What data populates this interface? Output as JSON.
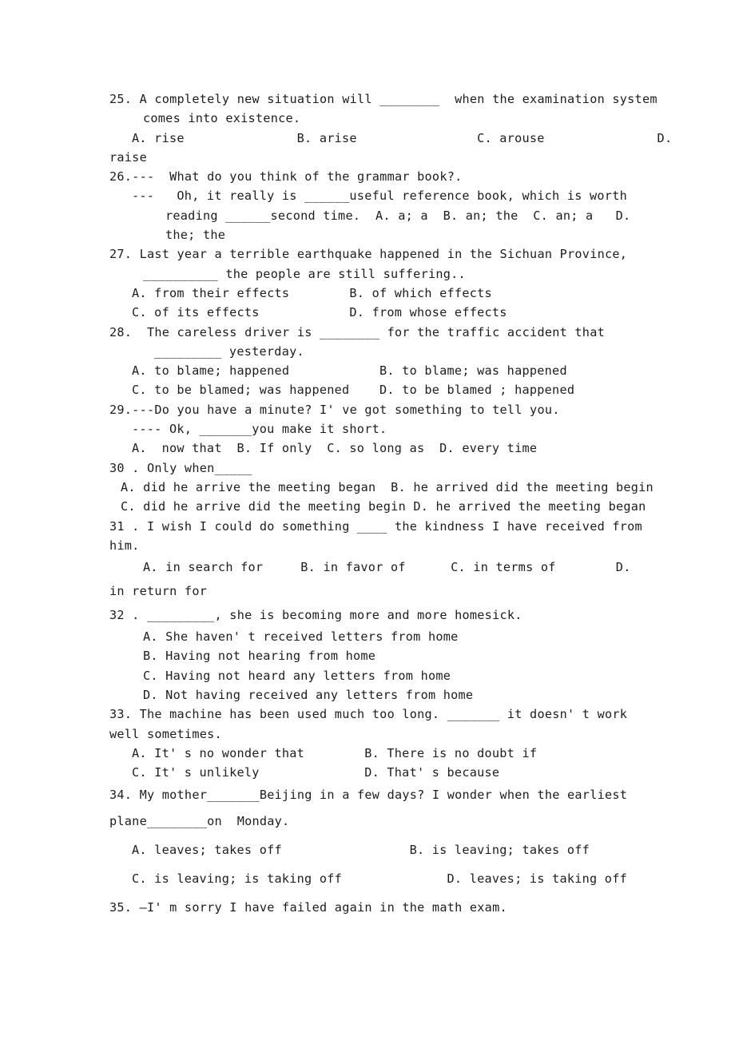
{
  "document": {
    "type": "english-grammar-multiple-choice-worksheet",
    "background_color": "#ffffff",
    "text_color": "#1d1d1d",
    "blank_placeholder": "________"
  },
  "questions": [
    {
      "number": "25.",
      "stem_lines": [
        "25. A completely new situation will ________  when the examination system",
        "   comes into existence."
      ],
      "option_lines": [
        "  A. rise                B. arise                 C. arouse               D.",
        "raise"
      ]
    },
    {
      "number": "26.",
      "stem_lines": [
        "26.---  What do you think of the grammar book?.",
        "  ---   Oh, it really is ______useful reference book, which is worth",
        "        reading ______second time.  A. a; a  B. an; the  C. an; a   D.",
        "        the; the"
      ],
      "option_lines": []
    },
    {
      "number": "27.",
      "stem_lines": [
        "27. Last year a terrible earthquake happened in the Sichuan Province,",
        "     __________ the people are still suffering.."
      ],
      "option_lines": [
        "  A. from their effects        B. of which effects",
        "  C. of its effects            D. from whose effects"
      ]
    },
    {
      "number": "28.",
      "stem_lines": [
        "28.  The careless driver is ________ for the traffic accident that",
        "      _________ yesterday."
      ],
      "option_lines": [
        "  A. to blame; happened            B. to blame; was happened",
        "  C. to be blamed; was happened    D. to be blamed ; happened"
      ]
    },
    {
      "number": "29.",
      "stem_lines": [
        "29.---Do you have a minute? I' ve got something to tell you.",
        "  ---- Ok, _______you make it short."
      ],
      "option_lines": [
        "  A.  now that  B. If only  C. so long as  D. every time"
      ]
    },
    {
      "number": "30.",
      "stem_lines": [
        "30 . Only when_____"
      ],
      "option_lines": [
        " A. did he arrive the meeting began  B. he arrived did the meeting begin",
        " C. did he arrive did the meeting begin D. he arrived the meeting began"
      ]
    },
    {
      "number": "31.",
      "stem_lines": [
        "31 . I wish I could do something ____ the kindness I have received from",
        "him."
      ],
      "option_lines": [
        "   A. in search for     B. in favor of      C. in terms of        D.",
        "in return for"
      ]
    },
    {
      "number": "32.",
      "stem_lines": [
        "32 . _________, she is becoming more and more homesick."
      ],
      "option_lines": [
        "   A. She haven' t received letters from home",
        "   B. Having not hearing from home",
        "   C. Having not heard any letters from home",
        "   D. Not having received any letters from home"
      ]
    },
    {
      "number": "33.",
      "stem_lines": [
        "33. The machine has been used much too long. _______ it doesn' t work",
        "well sometimes."
      ],
      "option_lines": [
        "   A. It' s no wonder that        B. There is no doubt if",
        "   C. It' s unlikely              D. That' s because"
      ]
    },
    {
      "number": "34.",
      "stem_lines": [
        "34. My mother_______Beijing in a few days? I wonder when the earliest",
        "plane________on  Monday."
      ],
      "option_lines": [
        "   A. leaves; takes off                 B. is leaving; takes off",
        "   C. is leaving; is taking off              D. leaves; is taking off"
      ]
    },
    {
      "number": "35.",
      "stem_lines": [
        "35. —I' m sorry I have failed again in the math exam."
      ],
      "option_lines": []
    }
  ],
  "lines": [
    {
      "id": "l01",
      "text": "25. A completely new situation will ________  when the examination system",
      "indent": 0,
      "spacing": "normal"
    },
    {
      "id": "l02",
      "text": "comes into existence.",
      "indent": 3,
      "spacing": "normal"
    },
    {
      "id": "l03",
      "text": "A. rise               B. arise                C. arouse               D.",
      "indent": 2,
      "spacing": "normal"
    },
    {
      "id": "l04",
      "text": "raise",
      "indent": 0,
      "spacing": "normal"
    },
    {
      "id": "l05",
      "text": "26.---  What do you think of the grammar book?.",
      "indent": 0,
      "spacing": "normal"
    },
    {
      "id": "l06",
      "text": "---   Oh, it really is ______useful reference book, which is worth",
      "indent": 2,
      "spacing": "normal"
    },
    {
      "id": "l07",
      "text": "reading ______second time.  A. a; a  B. an; the  C. an; a   D.",
      "indent": 5,
      "spacing": "normal"
    },
    {
      "id": "l08",
      "text": "the; the",
      "indent": 5,
      "spacing": "normal"
    },
    {
      "id": "l09",
      "text": "27. Last year a terrible earthquake happened in the Sichuan Province,",
      "indent": 0,
      "spacing": "normal"
    },
    {
      "id": "l10",
      "text": "__________ the people are still suffering..",
      "indent": 3,
      "spacing": "normal"
    },
    {
      "id": "l11",
      "text": "A. from their effects        B. of which effects",
      "indent": 2,
      "spacing": "normal"
    },
    {
      "id": "l12",
      "text": "C. of its effects            D. from whose effects",
      "indent": 2,
      "spacing": "normal"
    },
    {
      "id": "l13",
      "text": "28.  The careless driver is ________ for the traffic accident that",
      "indent": 0,
      "spacing": "normal"
    },
    {
      "id": "l14",
      "text": "_________ yesterday.",
      "indent": 4,
      "spacing": "normal"
    },
    {
      "id": "l15",
      "text": "A. to blame; happened            B. to blame; was happened",
      "indent": 2,
      "spacing": "normal"
    },
    {
      "id": "l16",
      "text": "C. to be blamed; was happened    D. to be blamed ; happened",
      "indent": 2,
      "spacing": "normal"
    },
    {
      "id": "l17",
      "text": "29.---Do you have a minute? I' ve got something to tell you.",
      "indent": 0,
      "spacing": "normal"
    },
    {
      "id": "l18",
      "text": "---- Ok, _______you make it short.",
      "indent": 2,
      "spacing": "normal"
    },
    {
      "id": "l19",
      "text": "A.  now that  B. If only  C. so long as  D. every time",
      "indent": 2,
      "spacing": "normal"
    },
    {
      "id": "l20",
      "text": "30 . Only when_____",
      "indent": 0,
      "spacing": "normal"
    },
    {
      "id": "l21",
      "text": "A. did he arrive the meeting began  B. he arrived did the meeting begin",
      "indent": 1,
      "spacing": "normal"
    },
    {
      "id": "l22",
      "text": "C. did he arrive did the meeting begin D. he arrived the meeting began",
      "indent": 1,
      "spacing": "normal"
    },
    {
      "id": "l23",
      "text": "31 . I wish I could do something ____ the kindness I have received from",
      "indent": 0,
      "spacing": "normal"
    },
    {
      "id": "l24",
      "text": "him.",
      "indent": 0,
      "spacing": "normal"
    },
    {
      "id": "l25",
      "text": "A. in search for     B. in favor of      C. in terms of        D.",
      "indent": 3,
      "spacing": "semi"
    },
    {
      "id": "l26",
      "text": "in return for",
      "indent": 0,
      "spacing": "semi"
    },
    {
      "id": "l27",
      "text": "32 . _________, she is becoming more and more homesick.",
      "indent": 0,
      "spacing": "semi"
    },
    {
      "id": "l28",
      "text": "A. She haven' t received letters from home",
      "indent": 3,
      "spacing": "normal"
    },
    {
      "id": "l29",
      "text": "B. Having not hearing from home",
      "indent": 3,
      "spacing": "normal"
    },
    {
      "id": "l30",
      "text": "C. Having not heard any letters from home",
      "indent": 3,
      "spacing": "normal"
    },
    {
      "id": "l31",
      "text": "D. Not having received any letters from home",
      "indent": 3,
      "spacing": "normal"
    },
    {
      "id": "l32",
      "text": "33. The machine has been used much too long. _______ it doesn' t work",
      "indent": 0,
      "spacing": "normal"
    },
    {
      "id": "l33",
      "text": "well sometimes.",
      "indent": 0,
      "spacing": "normal"
    },
    {
      "id": "l34",
      "text": "A. It' s no wonder that        B. There is no doubt if",
      "indent": 2,
      "spacing": "normal"
    },
    {
      "id": "l35",
      "text": "C. It' s unlikely              D. That' s because",
      "indent": 2,
      "spacing": "normal"
    },
    {
      "id": "l36",
      "text": "34. My mother_______Beijing in a few days? I wonder when the earliest",
      "indent": 0,
      "spacing": "semi"
    },
    {
      "id": "l37",
      "text": "plane________on  Monday.",
      "indent": 0,
      "spacing": "loose"
    },
    {
      "id": "l38",
      "text": "A. leaves; takes off                 B. is leaving; takes off",
      "indent": 2,
      "spacing": "loose"
    },
    {
      "id": "l39",
      "text": "C. is leaving; is taking off              D. leaves; is taking off",
      "indent": 2,
      "spacing": "loose"
    },
    {
      "id": "l40",
      "text": "35. —I' m sorry I have failed again in the math exam.",
      "indent": 0,
      "spacing": "loose"
    }
  ]
}
